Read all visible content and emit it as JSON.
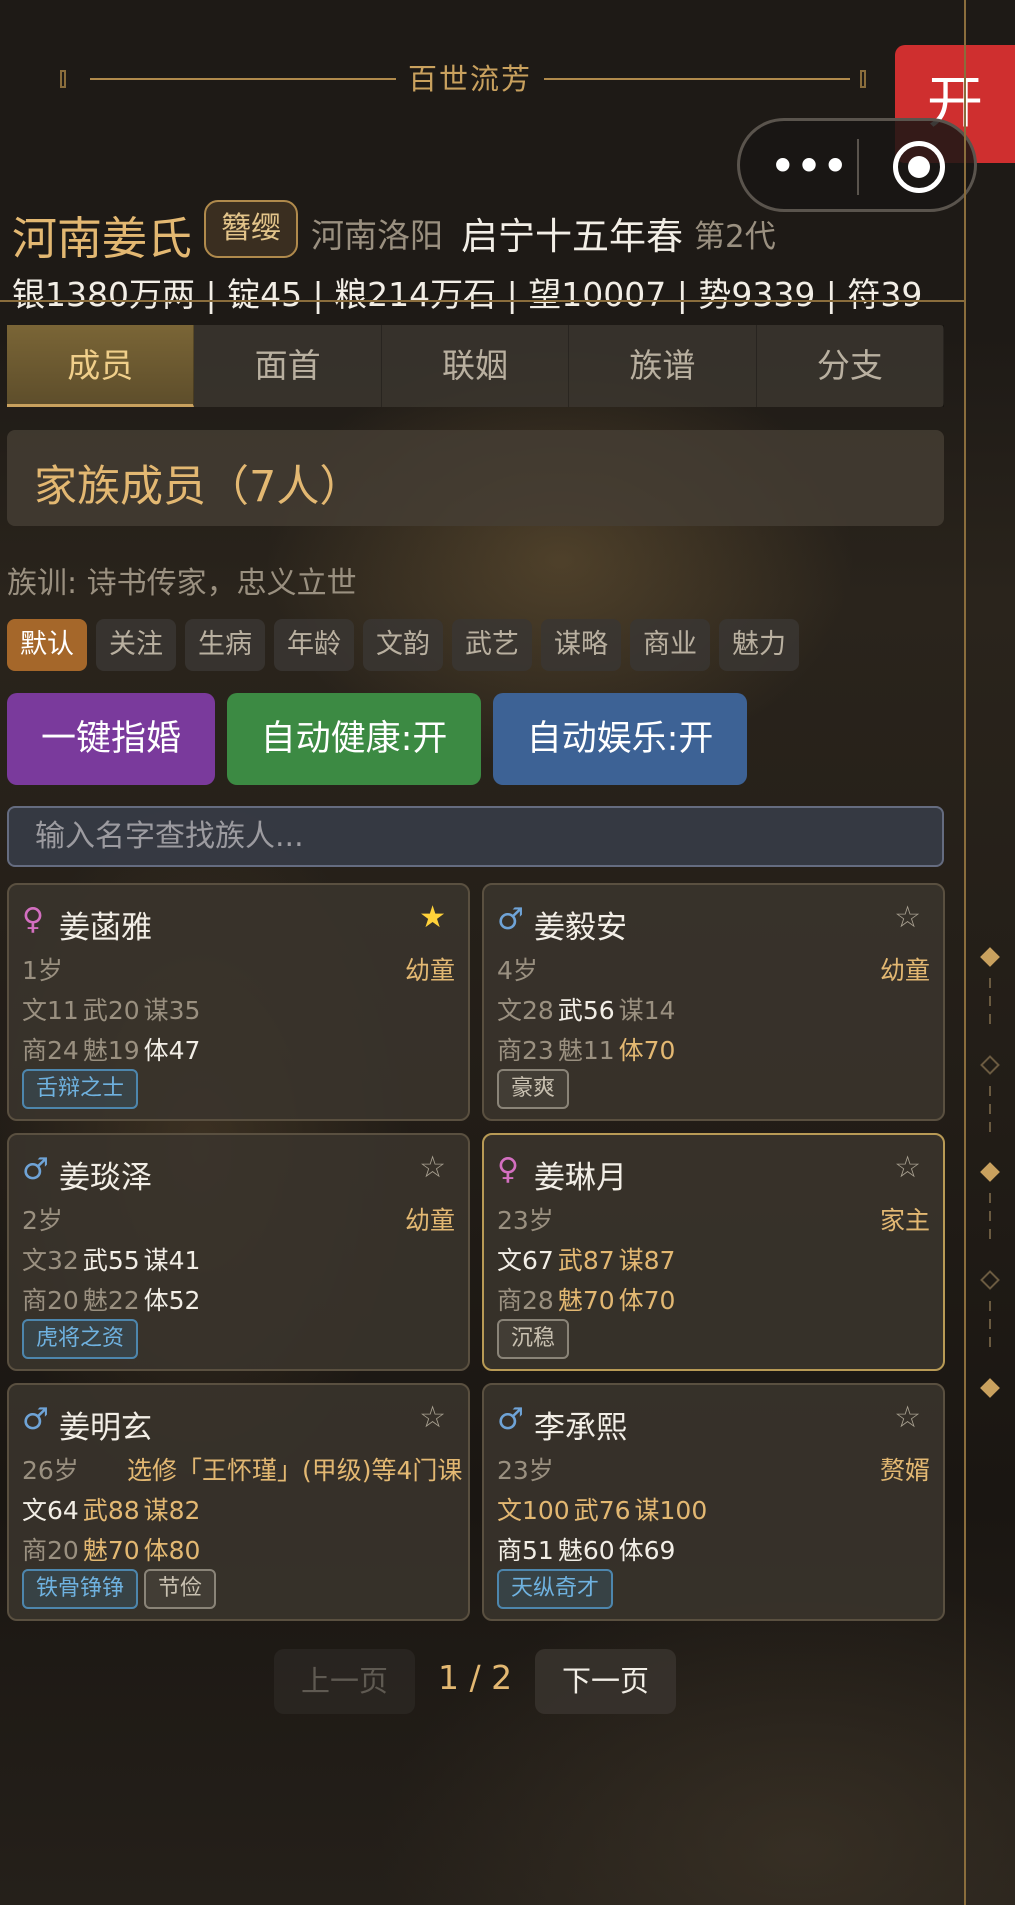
{
  "banner": {
    "title": "百世流芳"
  },
  "open_button": {
    "label": "开"
  },
  "capsule": {
    "menu_dots": "•••"
  },
  "header": {
    "clan_name": "河南姜氏",
    "rank_badge": "簪缨",
    "region": "河南洛阳",
    "season": "启宁十五年春",
    "generation": "第2代",
    "stats": "银1380万两 | 锭45 | 粮214万石 | 望10007 | 势9339 | 符39"
  },
  "tabs": [
    {
      "label": "成员",
      "active": true
    },
    {
      "label": "面首",
      "active": false
    },
    {
      "label": "联姻",
      "active": false
    },
    {
      "label": "族谱",
      "active": false
    },
    {
      "label": "分支",
      "active": false
    }
  ],
  "members_header": "家族成员（7人）",
  "motto": "族训: 诗书传家，忠义立世",
  "filters": [
    {
      "label": "默认",
      "active": true
    },
    {
      "label": "关注",
      "active": false
    },
    {
      "label": "生病",
      "active": false
    },
    {
      "label": "年龄",
      "active": false
    },
    {
      "label": "文韵",
      "active": false
    },
    {
      "label": "武艺",
      "active": false
    },
    {
      "label": "谋略",
      "active": false
    },
    {
      "label": "商业",
      "active": false
    },
    {
      "label": "魅力",
      "active": false
    }
  ],
  "actions": {
    "marry": "一键指婚",
    "auto_health": "自动健康:开",
    "auto_fun": "自动娱乐:开"
  },
  "search": {
    "placeholder": "输入名字查找族人..."
  },
  "colors": {
    "accent_gold": "#e3b872",
    "female": "#d36fc0",
    "male": "#6fa3d6",
    "favorite_star": "#ffd23a",
    "open_button": "#cf2f2f"
  },
  "members": [
    {
      "gender": "♀",
      "name": "姜菡雅",
      "favorite": true,
      "age": "1岁",
      "role": "幼童",
      "row1": [
        {
          "t": "文11",
          "lv": "low"
        },
        {
          "t": "武20",
          "lv": "low"
        },
        {
          "t": "谋35",
          "lv": "low"
        }
      ],
      "row2": [
        {
          "t": "商24",
          "lv": "low"
        },
        {
          "t": "魅19",
          "lv": "low"
        },
        {
          "t": "体47",
          "lv": "mid"
        }
      ],
      "tags": [
        {
          "t": "舌辩之士",
          "c": "blue"
        }
      ]
    },
    {
      "gender": "♂",
      "name": "姜毅安",
      "favorite": false,
      "age": "4岁",
      "role": "幼童",
      "row1": [
        {
          "t": "文28",
          "lv": "low"
        },
        {
          "t": "武56",
          "lv": "mid"
        },
        {
          "t": "谋14",
          "lv": "low"
        }
      ],
      "row2": [
        {
          "t": "商23",
          "lv": "low"
        },
        {
          "t": "魅11",
          "lv": "low"
        },
        {
          "t": "体70",
          "lv": "high"
        }
      ],
      "tags": [
        {
          "t": "豪爽",
          "c": "gray"
        }
      ]
    },
    {
      "gender": "♂",
      "name": "姜琰泽",
      "favorite": false,
      "age": "2岁",
      "role": "幼童",
      "row1": [
        {
          "t": "文32",
          "lv": "low"
        },
        {
          "t": "武55",
          "lv": "mid"
        },
        {
          "t": "谋41",
          "lv": "mid"
        }
      ],
      "row2": [
        {
          "t": "商20",
          "lv": "low"
        },
        {
          "t": "魅22",
          "lv": "low"
        },
        {
          "t": "体52",
          "lv": "mid"
        }
      ],
      "tags": [
        {
          "t": "虎将之资",
          "c": "blue"
        }
      ]
    },
    {
      "gender": "♀",
      "name": "姜琳月",
      "favorite": false,
      "age": "23岁",
      "role": "家主",
      "lord": true,
      "row1": [
        {
          "t": "文67",
          "lv": "mid"
        },
        {
          "t": "武87",
          "lv": "high"
        },
        {
          "t": "谋87",
          "lv": "high"
        }
      ],
      "row2": [
        {
          "t": "商28",
          "lv": "low"
        },
        {
          "t": "魅70",
          "lv": "high"
        },
        {
          "t": "体70",
          "lv": "high"
        }
      ],
      "tags": [
        {
          "t": "沉稳",
          "c": "gray"
        }
      ]
    },
    {
      "gender": "♂",
      "name": "姜明玄",
      "favorite": false,
      "age": "26岁",
      "role": "选修「王怀瑾」(甲级)等4门课",
      "role_is_course": true,
      "row1": [
        {
          "t": "文64",
          "lv": "mid"
        },
        {
          "t": "武88",
          "lv": "high"
        },
        {
          "t": "谋82",
          "lv": "high"
        }
      ],
      "row2": [
        {
          "t": "商20",
          "lv": "low"
        },
        {
          "t": "魅70",
          "lv": "high"
        },
        {
          "t": "体80",
          "lv": "high"
        }
      ],
      "tags": [
        {
          "t": "铁骨铮铮",
          "c": "blue"
        },
        {
          "t": "节俭",
          "c": "gray"
        }
      ]
    },
    {
      "gender": "♂",
      "name": "李承熙",
      "favorite": false,
      "age": "23岁",
      "role": "赘婿",
      "row1": [
        {
          "t": "文100",
          "lv": "high"
        },
        {
          "t": "武76",
          "lv": "high"
        },
        {
          "t": "谋100",
          "lv": "high"
        }
      ],
      "row2": [
        {
          "t": "商51",
          "lv": "mid"
        },
        {
          "t": "魅60",
          "lv": "mid"
        },
        {
          "t": "体69",
          "lv": "mid"
        }
      ],
      "tags": [
        {
          "t": "天纵奇才",
          "c": "blue"
        }
      ]
    }
  ],
  "pagination": {
    "prev": "上一页",
    "indicator": "1 / 2",
    "next": "下一页"
  }
}
